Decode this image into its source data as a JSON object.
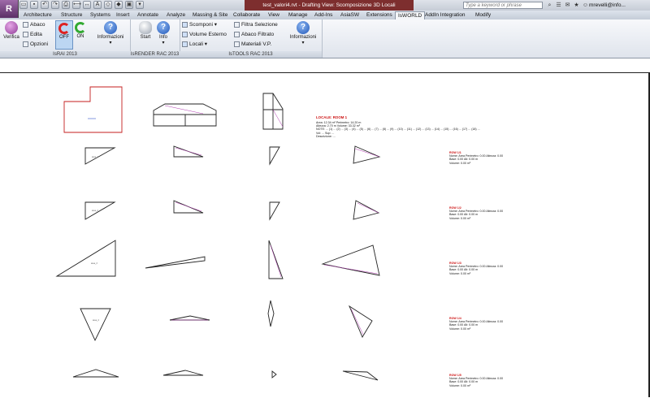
{
  "title_bar": {
    "app_button": "R",
    "document_title": "test_valori4.rvt - Drafting View: Scomposizione 3D Locali",
    "search_placeholder": "Type a keyword or phrase",
    "user": "mrevelli@info..."
  },
  "tabs": [
    {
      "label": "Architecture"
    },
    {
      "label": "Structure"
    },
    {
      "label": "Systems"
    },
    {
      "label": "Insert"
    },
    {
      "label": "Annotate"
    },
    {
      "label": "Analyze"
    },
    {
      "label": "Massing & Site"
    },
    {
      "label": "Collaborate"
    },
    {
      "label": "View"
    },
    {
      "label": "Manage"
    },
    {
      "label": "Add-Ins"
    },
    {
      "label": "AsiaSW"
    },
    {
      "label": "Extensions"
    },
    {
      "label": "IsWORLD"
    },
    {
      "label": "AddIn Integration"
    },
    {
      "label": "Modify"
    }
  ],
  "active_tab": "IsWORLD",
  "ribbon": {
    "israi": {
      "label": "IsRAI 2013",
      "verifica": "Verifica",
      "abaco": "Abaco",
      "edita": "Edita",
      "opzioni": "Opzioni",
      "off": "OFF",
      "on": "ON",
      "informazioni": "Informazioni"
    },
    "isrender": {
      "label": "IsRENDER RAC 2013",
      "start": "Start",
      "info": "Info"
    },
    "istools": {
      "label": "IsTOOLS RAC 2013",
      "scomponi": "Scomponi",
      "volume_esterno": "Volume Esterno",
      "locali": "Locali",
      "filtra_selezione": "Filtra Selezione",
      "abaco_filtrato": "Abaco Filtrato",
      "materiali_vp": "Materiali V.P.",
      "informazioni": "Informazioni"
    }
  },
  "drawing": {
    "header_title": "LOCALE: ROOM 1",
    "header_lines": [
      "Area: 12.34 m²  Perimetro: 14.20 m",
      "Altezza: 2.70 m  Volume: 33.32 m³",
      "NOTE: ... (1) ... (2) ... (3) ... (4) ... (5) ... (6) ... (7) ... (8) ... (9) ... (10) ... (11) ... (12) ... (13) ... (14) ... (15) ... (16) ... (17) ... (18) ...",
      "Vol: ...  Sup: ...",
      "Descrizione: ..."
    ],
    "labels": [
      {
        "title": "ROW 1/1",
        "lines": [
          "Nome: Area  Perimetro: 0.00  Altezza: 0.00",
          "Base: 0.00  Alt: 0.00 m",
          "Volume: 0.00 m³"
        ]
      },
      {
        "title": "ROW 1/2",
        "lines": [
          "Nome: Area  Perimetro: 0.00  Altezza: 0.00",
          "Base: 0.00  Alt: 0.00 m",
          "Volume: 0.00 m³"
        ]
      },
      {
        "title": "ROW 1/3",
        "lines": [
          "Nome: Area  Perimetro: 0.00  Altezza: 0.00",
          "Base: 0.00  Alt: 0.00 m",
          "Volume: 0.00 m³"
        ]
      },
      {
        "title": "ROW 1/4",
        "lines": [
          "Nome: Area  Perimetro: 0.00  Altezza: 0.00",
          "Base: 0.00  Alt: 0.00 m",
          "Volume: 0.00 m³"
        ]
      },
      {
        "title": "ROW 1/5",
        "lines": [
          "Nome: Area  Perimetro: 0.00  Altezza: 0.00",
          "Base: 0.00  Alt: 0.00 m",
          "Volume: 0.00 m³"
        ]
      }
    ]
  }
}
